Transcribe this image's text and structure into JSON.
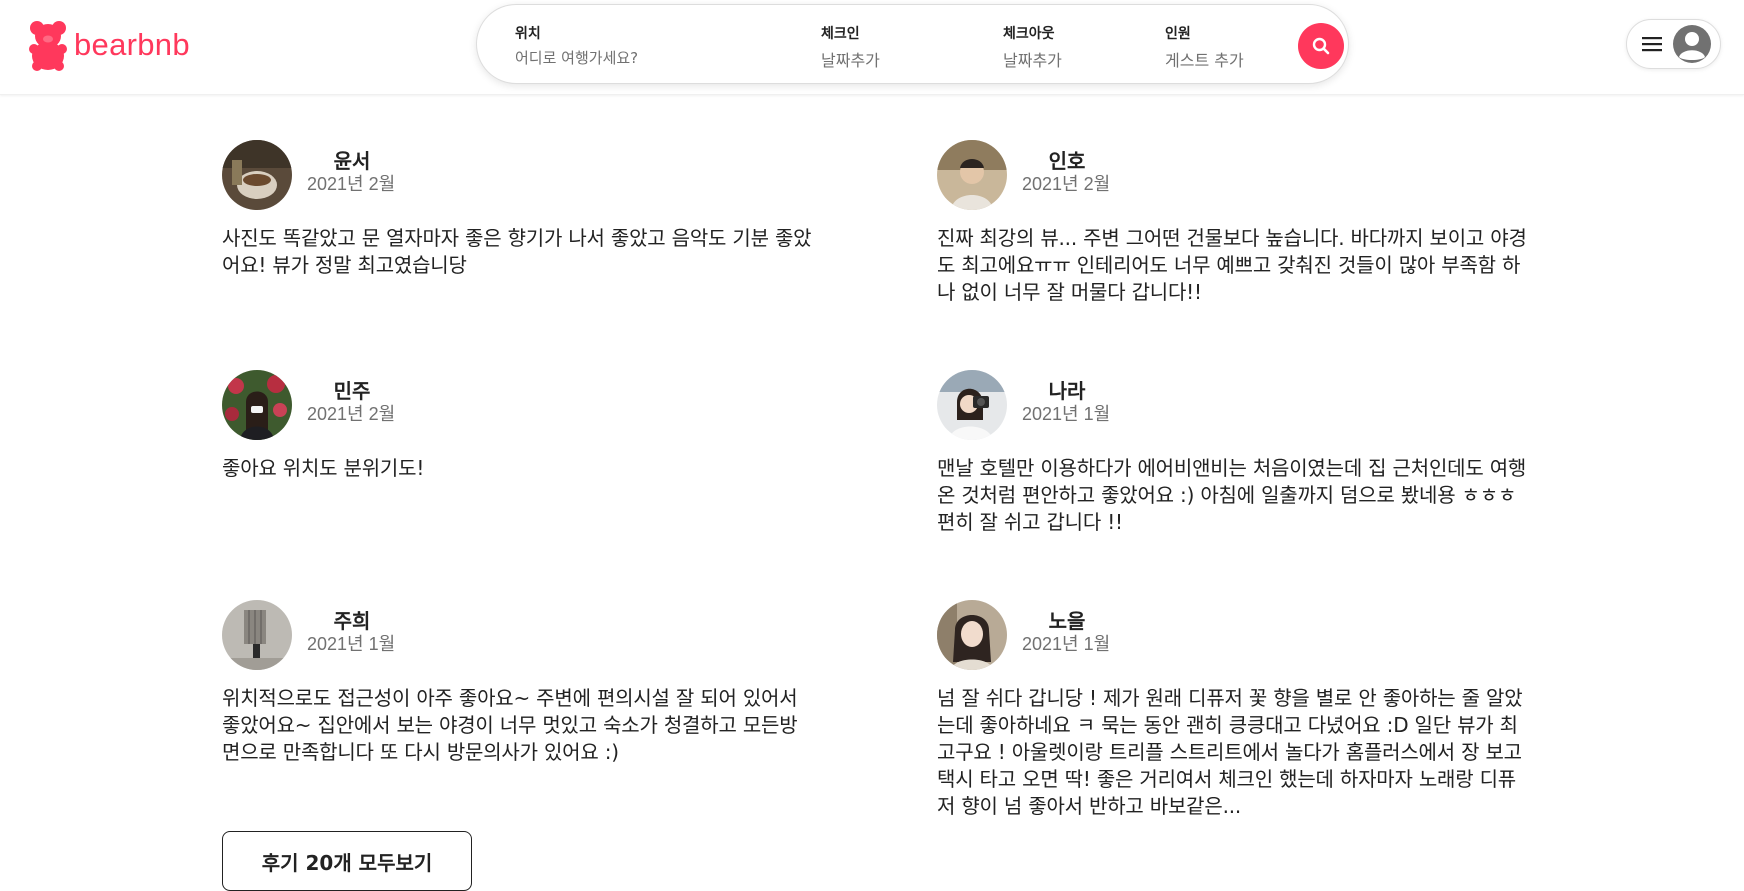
{
  "brand": {
    "name": "bearbnb",
    "color": "#ff385c"
  },
  "search": {
    "location": {
      "label": "위치",
      "placeholder": "어디로 여행가세요?"
    },
    "checkin": {
      "label": "체크인",
      "value": "날짜추가"
    },
    "checkout": {
      "label": "체크아웃",
      "value": "날짜추가"
    },
    "guests": {
      "label": "인원",
      "value": "게스트 추가"
    },
    "search_icon": "search-icon"
  },
  "user_menu": {
    "menu_icon": "hamburger-icon",
    "avatar_icon": "user-circle-icon"
  },
  "reviews": [
    {
      "name": "윤서",
      "date": "2021년 2월",
      "text": "사진도 똑같았고 문 열자마자 좋은 향기가 나서 좋았고 음악도 기분 좋았어요! 뷰가 정말 최고였습니당"
    },
    {
      "name": "인호",
      "date": "2021년 2월",
      "text": "진짜 최강의 뷰... 주변 그어떤 건물보다 높습니다. 바다까지 보이고 야경도 최고에요ㅠㅠ 인테리어도 너무 예쁘고 갖춰진 것들이 많아 부족함 하나 없이 너무 잘 머물다 갑니다!!"
    },
    {
      "name": "민주",
      "date": "2021년 2월",
      "text": "좋아요 위치도 분위기도!"
    },
    {
      "name": "나라",
      "date": "2021년 1월",
      "text": "맨날 호텔만 이용하다가 에어비앤비는 처음이였는데 집 근처인데도 여행온 것처럼 편안하고 좋았어요 :) 아침에 일출까지 덤으로 봤네용 ㅎㅎㅎ 편히 잘 쉬고 갑니다 !!"
    },
    {
      "name": "주희",
      "date": "2021년 1월",
      "text": "위치적으로도 접근성이 아주 좋아요~ 주변에 편의시설 잘 되어 있어서 좋았어요~ 집안에서 보는 야경이 너무 멋있고 숙소가 청결하고 모든방면으로 만족합니다 또 다시 방문의사가 있어요 :)"
    },
    {
      "name": "노을",
      "date": "2021년 1월",
      "text": "넘 잘 쉬다 갑니당 ! 제가 원래 디퓨저 꽃 향을 별로 안 좋아하는 줄 알았는데 좋아하네요 ㅋ 묵는 동안 괜히 킁킁대고 다녔어요 :D 일단 뷰가 최고구요 ! 아울렛이랑 트리플 스트리트에서 놀다가 홈플러스에서 장 보고 택시 타고 오면 딱! 좋은 거리여서 체크인 했는데 하자마자 노래랑 디퓨저 향이 넘 좋아서 반하고 바보같은..."
    }
  ],
  "all_reviews_button": "후기 20개 모두보기"
}
